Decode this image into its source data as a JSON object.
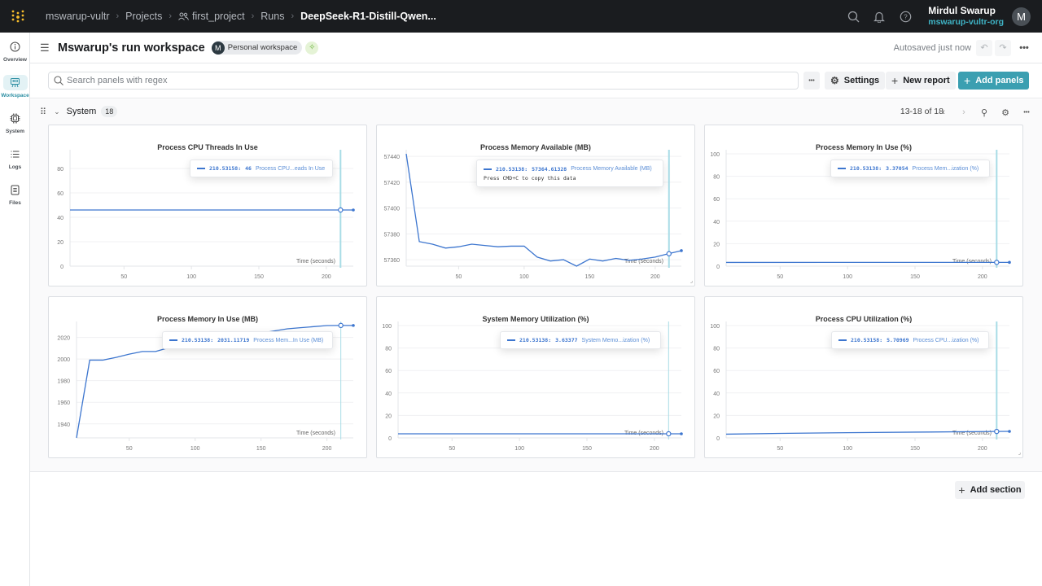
{
  "topbar": {
    "breadcrumbs": [
      "mswarup-vultr",
      "Projects",
      "first_project",
      "Runs",
      "DeepSeek-R1-Distill-Qwen..."
    ],
    "user_name": "Mirdul Swarup",
    "user_org": "mswarup-vultr-org",
    "avatar_initial": "M",
    "icons": [
      "search-icon",
      "bell-icon",
      "help-icon"
    ]
  },
  "leftnav": {
    "items": [
      {
        "label": "Overview",
        "icon": "info-icon",
        "active": false
      },
      {
        "label": "Workspace",
        "icon": "workspace-icon",
        "active": true
      },
      {
        "label": "System",
        "icon": "chip-icon",
        "active": false
      },
      {
        "label": "Logs",
        "icon": "list-icon",
        "active": false
      },
      {
        "label": "Files",
        "icon": "file-icon",
        "active": false
      }
    ]
  },
  "header": {
    "title": "Mswarup's run workspace",
    "workspace_initial": "M",
    "workspace_badge": "Personal workspace",
    "autosave": "Autosaved just now"
  },
  "toolbar": {
    "search_placeholder": "Search panels with regex",
    "search_value": "",
    "settings_label": "Settings",
    "new_report_label": "New report",
    "add_panels_label": "Add panels"
  },
  "section": {
    "name": "System",
    "count": "18",
    "pager": "13-18 of 18"
  },
  "add_section_label": "Add section",
  "colors": {
    "accent": "#3b9fb1",
    "line": "#3d76cf",
    "crosshair": "#a8dce6"
  },
  "chart_data": [
    {
      "type": "line",
      "title": "Process CPU Threads In Use",
      "xlabel": "Time (seconds)",
      "ylabel": "",
      "xlim": [
        10,
        220
      ],
      "ylim": [
        0,
        92
      ],
      "xticks": [
        50,
        100,
        150,
        200
      ],
      "yticks": [
        0,
        20,
        40,
        60,
        80
      ],
      "x": [
        10,
        220
      ],
      "y": [
        46,
        46
      ],
      "hover": {
        "x": 210.53158,
        "y": 46,
        "label": "210.53158:",
        "value": "46",
        "series": "Process CPU...eads In Use"
      }
    },
    {
      "type": "line",
      "title": "Process Memory Available (MB)",
      "xlabel": "Time (seconds)",
      "ylabel": "",
      "xlim": [
        10,
        220
      ],
      "ylim": [
        57355,
        57442
      ],
      "xticks": [
        50,
        100,
        150,
        200
      ],
      "yticks": [
        57360,
        57380,
        57400,
        57420,
        57440
      ],
      "x": [
        10,
        20,
        30,
        40,
        50,
        60,
        70,
        80,
        90,
        100,
        110,
        120,
        130,
        140,
        150,
        160,
        170,
        180,
        190,
        200,
        210,
        220
      ],
      "y": [
        57442,
        57374,
        57372,
        57369,
        57370,
        57372,
        57371,
        57370,
        57370.5,
        57370.5,
        57362,
        57359,
        57360,
        57355,
        57360.5,
        57359,
        57361,
        57359.5,
        57360.5,
        57362,
        57364.6,
        57367
      ],
      "hover": {
        "x": 210.53138,
        "y": 57364.61328,
        "label": "210.53138:",
        "value": "57364.61328",
        "series": "Process Memory Available (MB)",
        "note": "Press CMD+C to copy this data"
      }
    },
    {
      "type": "line",
      "title": "Process Memory In Use (%)",
      "xlabel": "Time (seconds)",
      "ylabel": "",
      "xlim": [
        10,
        220
      ],
      "ylim": [
        0,
        100
      ],
      "xticks": [
        50,
        100,
        150,
        200
      ],
      "yticks": [
        0,
        20,
        40,
        60,
        80,
        100
      ],
      "x": [
        10,
        220
      ],
      "y": [
        3.3,
        3.37
      ],
      "hover": {
        "x": 210.53138,
        "y": 3.37054,
        "label": "210.53138:",
        "value": "3.37054",
        "series": "Process Mem...ization (%)"
      }
    },
    {
      "type": "line",
      "title": "Process Memory In Use (MB)",
      "xlabel": "Time (seconds)",
      "ylabel": "",
      "xlim": [
        10,
        220
      ],
      "ylim": [
        1927,
        2031
      ],
      "xticks": [
        50,
        100,
        150,
        200
      ],
      "yticks": [
        1940,
        1960,
        1980,
        2000,
        2020
      ],
      "x": [
        10,
        20,
        30,
        40,
        50,
        60,
        70,
        80,
        90,
        100,
        110,
        120,
        130,
        140,
        150,
        160,
        170,
        180,
        190,
        200,
        210,
        220
      ],
      "y": [
        1927,
        1999,
        1999,
        2001.5,
        2004.5,
        2007,
        2007,
        2010.5,
        2010.5,
        2014,
        2016,
        2018,
        2020,
        2022,
        2024,
        2026,
        2028,
        2029,
        2030,
        2031,
        2031.1,
        2031.1
      ],
      "hover": {
        "x": 210.53138,
        "y": 2031.11719,
        "label": "210.53138:",
        "value": "2031.11719",
        "series": "Process Mem...In Use (MB)"
      }
    },
    {
      "type": "line",
      "title": "System Memory Utilization (%)",
      "xlabel": "Time (seconds)",
      "ylabel": "",
      "xlim": [
        10,
        220
      ],
      "ylim": [
        0,
        100
      ],
      "xticks": [
        50,
        100,
        150,
        200
      ],
      "yticks": [
        0,
        20,
        40,
        60,
        80,
        100
      ],
      "x": [
        10,
        220
      ],
      "y": [
        3.6,
        3.63
      ],
      "hover": {
        "x": 210.53138,
        "y": 3.63377,
        "label": "210.53138:",
        "value": "3.63377",
        "series": "System Memo...ization (%)"
      }
    },
    {
      "type": "line",
      "title": "Process CPU Utilization (%)",
      "xlabel": "Time (seconds)",
      "ylabel": "",
      "xlim": [
        10,
        220
      ],
      "ylim": [
        0,
        100
      ],
      "xticks": [
        50,
        100,
        150,
        200
      ],
      "yticks": [
        0,
        20,
        40,
        60,
        80,
        100
      ],
      "x": [
        10,
        50,
        100,
        150,
        200,
        220
      ],
      "y": [
        3.3,
        4.0,
        4.6,
        5.1,
        5.6,
        5.8
      ],
      "hover": {
        "x": 210.53158,
        "y": 5.70969,
        "label": "210.53158:",
        "value": "5.70969",
        "series": "Process CPU...ization (%)"
      }
    }
  ]
}
